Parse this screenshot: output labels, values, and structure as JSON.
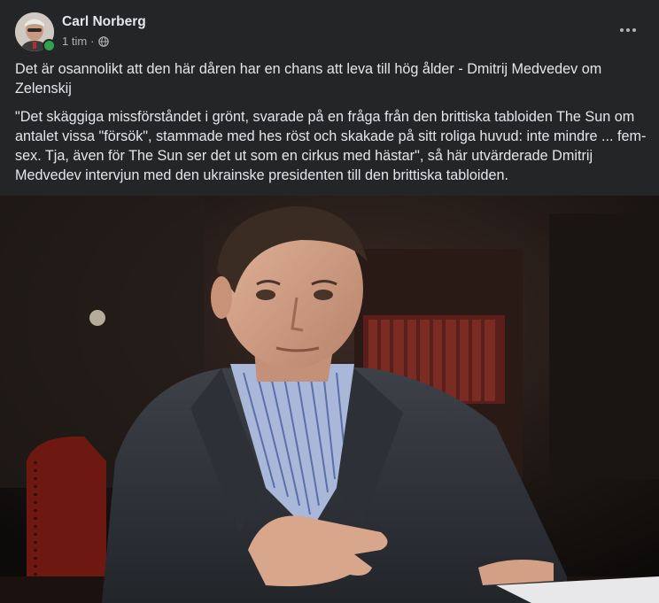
{
  "post": {
    "author": "Carl Norberg",
    "time": "1 tim",
    "separator": "·",
    "privacy_icon": "globe-icon",
    "more_icon": "more-horizontal-icon",
    "headline": "Det är osannolikt att den här dåren har en chans att leva till hög ålder - Dmitrij Medvedev om Zelenskij",
    "body": "\"Det skäggiga missförståndet i grönt, svarade på en fråga från den brittiska tabloiden The Sun om antalet vissa \"försök\", stammade med hes röst och skakade på sitt roliga huvud: inte mindre ... fem-sex. Tja, även för The Sun ser det ut som en cirkus med hästar\", så här utvärderade Dmitrij Medvedev intervjun med den ukrainske presidenten till den brittiska tabloiden."
  },
  "colors": {
    "background": "#242526",
    "primary_text": "#e4e6eb",
    "secondary_text": "#b0b3b8",
    "online": "#31a24c"
  }
}
